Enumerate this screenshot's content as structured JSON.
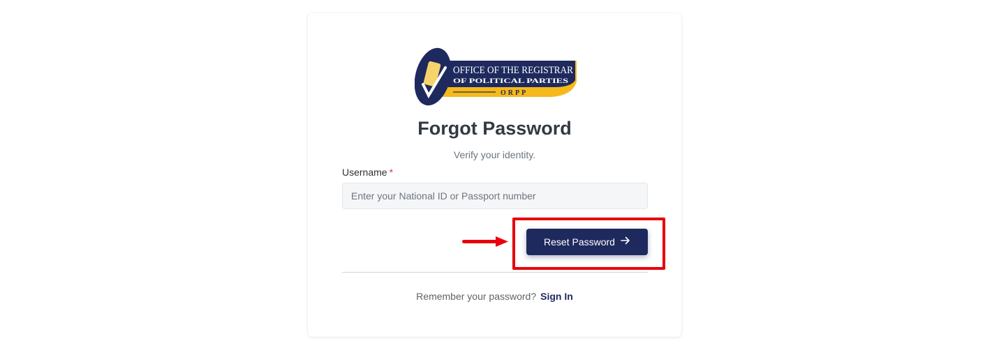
{
  "logo": {
    "line1": "OFFICE OF THE REGISTRAR",
    "line2": "OF POLITICAL PARTIES",
    "acronym": "ORPP",
    "colors": {
      "navy": "#1e2a5e",
      "gold": "#f6b91b"
    }
  },
  "form": {
    "title": "Forgot Password",
    "subtitle": "Verify your identity.",
    "username_label": "Username",
    "required_mark": "*",
    "username_placeholder": "Enter your National ID or Passport number",
    "username_value": "",
    "submit_label": "Reset Password",
    "submit_icon": "arrow-right-icon"
  },
  "footer": {
    "prompt": "Remember your password?",
    "link_label": "Sign In"
  },
  "annotation": {
    "highlight_color": "#e8000b"
  }
}
